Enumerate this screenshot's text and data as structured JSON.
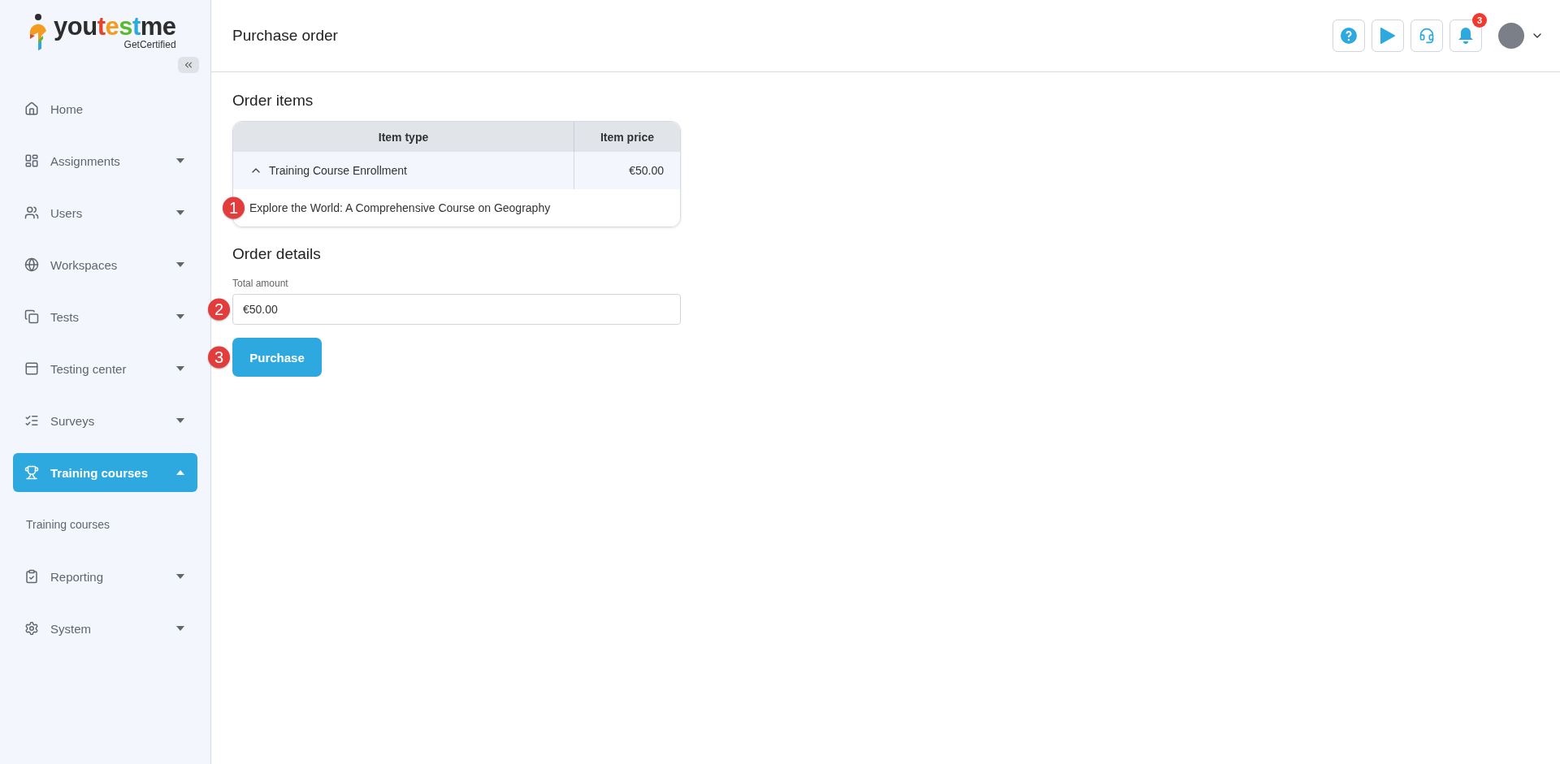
{
  "logo": {
    "parts": [
      {
        "text": "you",
        "color": "#2d2d2d"
      },
      {
        "text": "t",
        "color": "#e2452c"
      },
      {
        "text": "e",
        "color": "#f39c1f"
      },
      {
        "text": "s",
        "color": "#5cb833"
      },
      {
        "text": "t",
        "color": "#2ea9e0"
      },
      {
        "text": "me",
        "color": "#2d2d2d"
      }
    ],
    "tagline": "GetCertified"
  },
  "sidebar": {
    "items": [
      {
        "label": "Home",
        "selected": false
      },
      {
        "label": "Assignments",
        "selected": false,
        "expanded": false
      },
      {
        "label": "Users",
        "selected": false,
        "expanded": false
      },
      {
        "label": "Workspaces",
        "selected": false,
        "expanded": false
      },
      {
        "label": "Tests",
        "selected": false,
        "expanded": false
      },
      {
        "label": "Testing center",
        "selected": false,
        "expanded": false
      },
      {
        "label": "Surveys",
        "selected": false,
        "expanded": false
      },
      {
        "label": "Training courses",
        "selected": true,
        "expanded": true,
        "children": [
          {
            "label": "Training courses",
            "selected": false
          }
        ]
      },
      {
        "label": "Reporting",
        "selected": false,
        "expanded": false
      },
      {
        "label": "System",
        "selected": false,
        "expanded": false
      }
    ]
  },
  "header": {
    "title": "Purchase order",
    "notification_count": "3"
  },
  "order_items": {
    "title": "Order items",
    "columns": [
      "Item type",
      "Item price"
    ],
    "rows": [
      {
        "item_type": "Training Course Enrollment",
        "item_price": "€50.00",
        "expanded": true,
        "children": [
          {
            "name": "Explore the World: A Comprehensive Course on Geography",
            "annotation": "1"
          }
        ]
      }
    ]
  },
  "order_details": {
    "title": "Order details",
    "total_amount": {
      "label": "Total amount",
      "value": "€50.00",
      "annotation": "2"
    },
    "purchase_button": {
      "label": "Purchase",
      "annotation": "3"
    }
  }
}
